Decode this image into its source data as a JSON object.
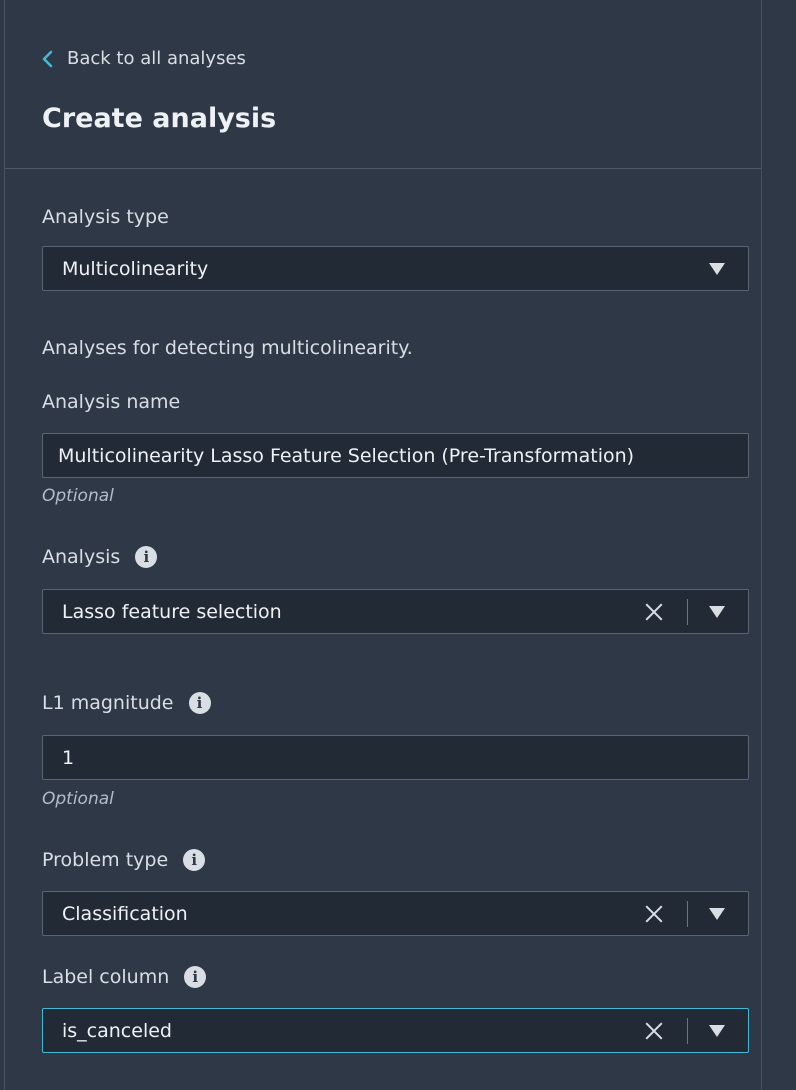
{
  "header": {
    "back_label": "Back to all analyses",
    "title": "Create analysis"
  },
  "analysis_type": {
    "label": "Analysis type",
    "value": "Multicolinearity",
    "description": "Analyses for detecting multicolinearity."
  },
  "analysis_name": {
    "label": "Analysis name",
    "value": "Multicolinearity Lasso Feature Selection (Pre-Transformation)",
    "hint": "Optional"
  },
  "analysis": {
    "label": "Analysis",
    "value": "Lasso feature selection"
  },
  "l1_magnitude": {
    "label": "L1 magnitude",
    "value": "1",
    "hint": "Optional"
  },
  "problem_type": {
    "label": "Problem type",
    "value": "Classification"
  },
  "label_column": {
    "label": "Label column",
    "value": "is_canceled"
  },
  "colors": {
    "background": "#2f3846",
    "field_background": "#222a36",
    "focus_border": "#44b9d6",
    "accent_chevron": "#44b9d6"
  },
  "icons": {
    "back": "chevron-left-icon",
    "info": "info-icon",
    "clear": "close-icon",
    "dropdown": "caret-down-icon"
  }
}
